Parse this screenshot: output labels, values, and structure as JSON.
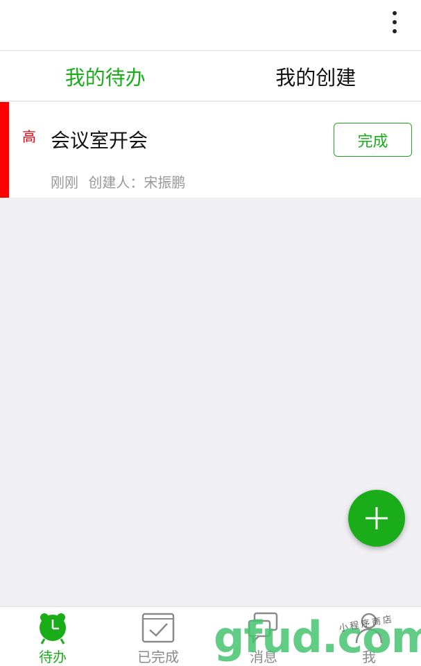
{
  "topbar": {
    "more_icon": "more-vertical-icon"
  },
  "tabs": [
    {
      "label": "我的待办",
      "active": true
    },
    {
      "label": "我的创建",
      "active": false
    }
  ],
  "task": {
    "priority": "高",
    "title": "会议室开会",
    "time": "刚刚",
    "creator": "创建人：宋振鹏",
    "action_label": "完成"
  },
  "fab": {
    "icon": "plus-icon"
  },
  "bottom_nav": [
    {
      "label": "待办",
      "icon": "alarm-clock-icon",
      "active": true
    },
    {
      "label": "已完成",
      "icon": "checkbox-icon",
      "active": false
    },
    {
      "label": "消息",
      "icon": "chat-bubbles-icon",
      "active": false
    },
    {
      "label": "我",
      "icon": "person-icon",
      "active": false
    }
  ],
  "watermark": {
    "logo": "gfud.com",
    "subtitle": "小程序商店"
  },
  "colors": {
    "accent": "#1aad19",
    "priority_high": "#ff0000",
    "background": "#efeff4"
  }
}
